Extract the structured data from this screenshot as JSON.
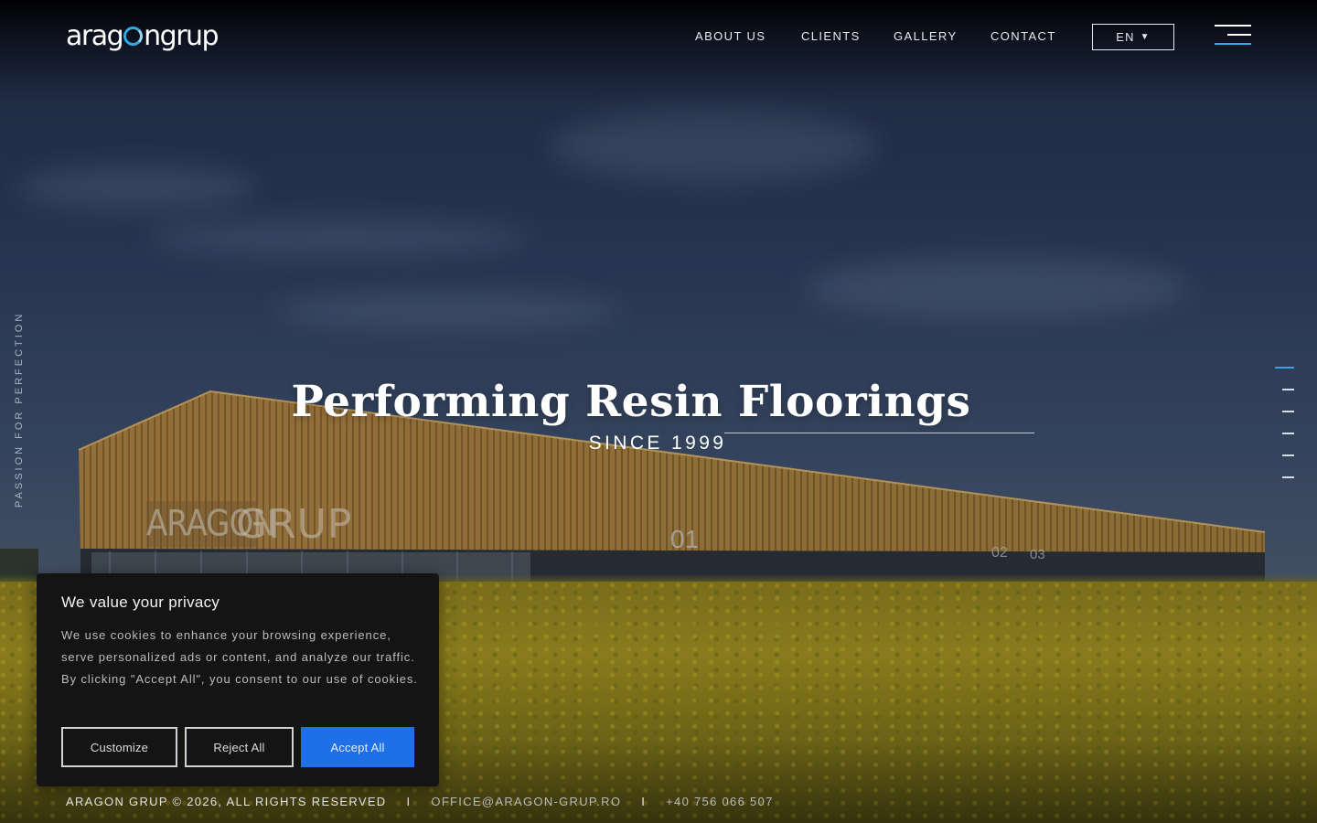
{
  "brand": {
    "logo_part1": "arag",
    "logo_part2": "ngrup",
    "accent_color": "#2fa9e0"
  },
  "header": {
    "nav": [
      {
        "label": "ABOUT US"
      },
      {
        "label": "CLIENTS"
      },
      {
        "label": "GALLERY"
      },
      {
        "label": "CONTACT"
      }
    ],
    "language": "EN",
    "language_icon": "caret-down-icon",
    "menu_icon": "hamburger-menu-icon"
  },
  "side": {
    "tagline": "PASSION FOR PERFECTION",
    "slides_total": 6,
    "active_slide": 1
  },
  "hero": {
    "title": "Performing Resin Floorings",
    "subtitle": "SINCE 1999"
  },
  "footer": {
    "copyright": "ARAGON GRUP © 2026, ALL RIGHTS RESERVED",
    "separator": "I",
    "email": "OFFICE@ARAGON-GRUP.RO",
    "phone": "+40 756 066 507"
  },
  "cookie_banner": {
    "title": "We value your privacy",
    "text": "We use cookies to enhance your browsing experience, serve personalized ads or content, and analyze our traffic. By clicking \"Accept All\", you consent to our use of cookies.",
    "customize_label": "Customize",
    "reject_label": "Reject All",
    "accept_label": "Accept All",
    "accept_color": "#1f6fe8"
  },
  "building_signage": {
    "brand_left": "ARAGON",
    "brand_right": "GRUP",
    "unit_01": "01",
    "unit_02": "02",
    "unit_03": "03"
  }
}
